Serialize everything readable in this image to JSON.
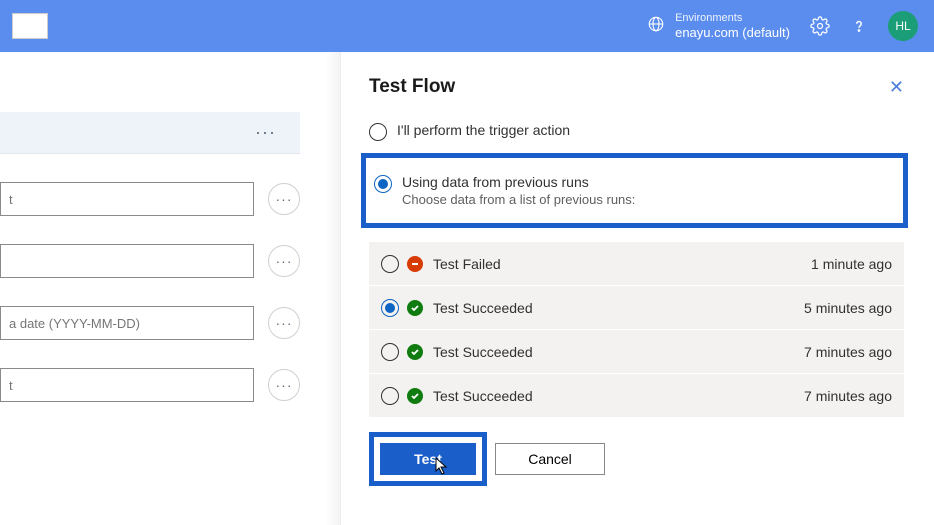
{
  "header": {
    "env_label": "Environments",
    "env_value": "enayu.com (default)",
    "avatar": "HL"
  },
  "left": {
    "fields": [
      {
        "placeholder": "t"
      },
      {
        "placeholder": ""
      },
      {
        "placeholder": "a date (YYYY-MM-DD)"
      },
      {
        "placeholder": "t"
      }
    ]
  },
  "panel": {
    "title": "Test Flow",
    "option_manual": "I'll perform the trigger action",
    "option_previous": "Using data from previous runs",
    "option_previous_sub": "Choose data from a list of previous runs:",
    "runs": [
      {
        "status": "fail",
        "label": "Test Failed",
        "time": "1 minute ago",
        "selected": false
      },
      {
        "status": "success",
        "label": "Test Succeeded",
        "time": "5 minutes ago",
        "selected": true
      },
      {
        "status": "success",
        "label": "Test Succeeded",
        "time": "7 minutes ago",
        "selected": false
      },
      {
        "status": "success",
        "label": "Test Succeeded",
        "time": "7 minutes ago",
        "selected": false
      }
    ],
    "test_btn": "Test",
    "cancel_btn": "Cancel"
  }
}
